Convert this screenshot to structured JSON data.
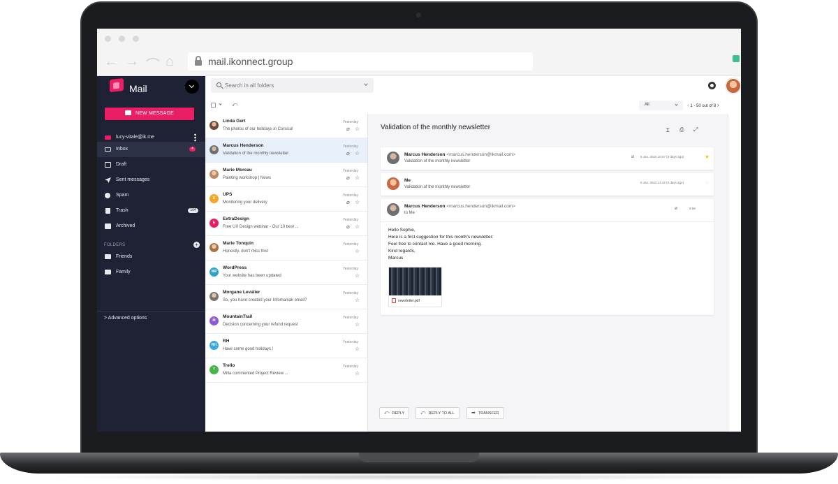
{
  "browser": {
    "url": "mail.ikonnect.group",
    "nav_back": "←",
    "nav_forward": "→",
    "nav_reload": "⌒",
    "nav_home": "⌂"
  },
  "sidebar": {
    "app_title": "Mail",
    "new_message": "NEW MESSAGE",
    "account": "lucy-vitale@ik.me",
    "items": [
      {
        "label": "Inbox",
        "badge": "4"
      },
      {
        "label": "Draft"
      },
      {
        "label": "Sent messages"
      },
      {
        "label": "Spam"
      },
      {
        "label": "Trash",
        "badge": "104"
      },
      {
        "label": "Archived"
      }
    ],
    "folders_title": "FOLDERS",
    "folders_add": "+",
    "folders": [
      "Friends",
      "Family"
    ],
    "advanced": "> Advanced options"
  },
  "topbar": {
    "search_placeholder": "Search in all folders"
  },
  "toolbar": {
    "filter": "All",
    "pager": "1 - 50 out of 8",
    "pager_prev": "‹",
    "pager_next": "›"
  },
  "list": [
    {
      "sender": "Linda Gert",
      "subject": "The photos of our holidays in Corsica!",
      "date": "Yesterday",
      "clip": true
    },
    {
      "sender": "Marcus Henderson",
      "subject": "Validation of the monthly newsletter",
      "date": "Yesterday",
      "clip": true
    },
    {
      "sender": "Marie Moreau",
      "subject": "Painting workshop | News",
      "date": "Yesterday",
      "clip": true
    },
    {
      "sender": "UPS",
      "subject": "Monitoring your delivery",
      "date": "Yesterday",
      "clip": true,
      "initials": "U",
      "color": "#f5a623"
    },
    {
      "sender": "ExtraDesign",
      "subject": "Free UX Design webinar - Our 10 best ...",
      "date": "Yesterday",
      "clip": true,
      "initials": "E",
      "color": "#e91e63"
    },
    {
      "sender": "Marie Tonquin",
      "subject": "Honestly, don't miss this!",
      "date": "Yesterday"
    },
    {
      "sender": "WordPress",
      "subject": "Your website has been updated",
      "date": "Yesterday",
      "initials": "WP",
      "color": "#2ea3c7"
    },
    {
      "sender": "Morgane Levalier",
      "subject": "So, you have created your Infomaniak email?",
      "date": "Yesterday"
    },
    {
      "sender": "MountainTrail",
      "subject": "Decision concerning your refund request",
      "date": "Yesterday",
      "initials": "M",
      "color": "#8e5bd6"
    },
    {
      "sender": "RH",
      "subject": "Have some good holidays !",
      "date": "Yesterday",
      "initials": "RH",
      "color": "#3ba6e8"
    },
    {
      "sender": "Trello",
      "subject": "Milla commented Project Review ...",
      "date": "Yesterday",
      "initials": "T",
      "color": "#43b649"
    }
  ],
  "reader": {
    "title": "Validation of the monthly newsletter",
    "messages": [
      {
        "from": "Marcus Henderson",
        "email": "<marcus.henderson@ikmail.com>",
        "subject": "Validation of the monthly newsletter",
        "date": "5 Jan. 2022 10:07 (3 days ago)"
      },
      {
        "from": "Me",
        "subject": "Validation of the monthly newsletter",
        "date": "5 Jan. 2022 11:42 (3 days ago)"
      },
      {
        "from": "Marcus Henderson",
        "email": "<marcus.henderson@ikmail.com>",
        "to": "to Me",
        "date": "9:59"
      }
    ],
    "body": [
      "Hello Sophie,",
      "Here is a first suggestion for this month's newsletter:",
      "Feel free to contact me. Have a good morning.",
      "Kind regards,",
      "Marcus"
    ],
    "attachment": "newsletter.pdf",
    "actions": {
      "reply": "REPLY",
      "reply_all": "REPLY TO ALL",
      "transfer": "TRANSFER"
    }
  },
  "colors": {
    "accent": "#e91e63",
    "sidebar_bg": "#1f2234",
    "active_row": "#e8f1fb",
    "star": "#f5c518"
  }
}
